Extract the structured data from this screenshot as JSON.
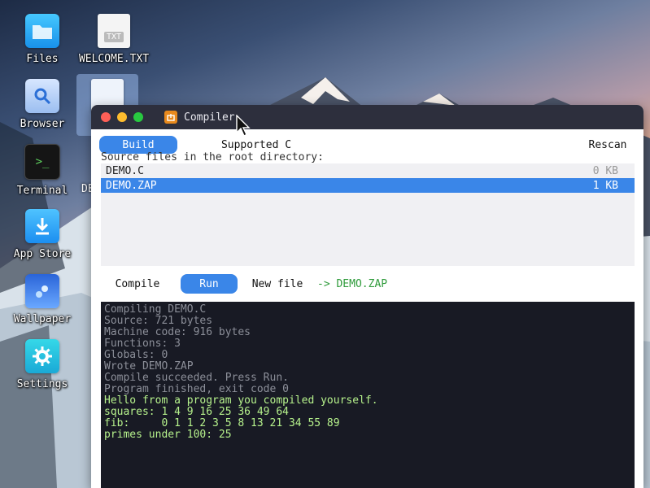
{
  "desktop": {
    "icons": [
      {
        "label": "Files",
        "icon": "folder-icon"
      },
      {
        "label": "WELCOME.TXT",
        "icon": "text-file-icon",
        "badge": "TXT"
      },
      {
        "label": "Browser",
        "icon": "magnifier-icon"
      },
      {
        "label": "Terminal",
        "icon": "terminal-icon",
        "glyph": ">_"
      },
      {
        "label": "DE",
        "icon": "file-icon"
      },
      {
        "label": "App Store",
        "icon": "download-icon"
      },
      {
        "label": "Wallpaper",
        "icon": "wallpaper-icon"
      },
      {
        "label": "Settings",
        "icon": "gear-icon"
      }
    ]
  },
  "window": {
    "title": "Compiler",
    "tabs": {
      "build": "Build",
      "supported": "Supported C"
    },
    "rescan": "Rescan",
    "hint": "Source files in the root directory:",
    "files": [
      {
        "name": "DEMO.C",
        "size": "0 KB",
        "selected": false
      },
      {
        "name": "DEMO.ZAP",
        "size": "1 KB",
        "selected": true
      }
    ],
    "actions": {
      "compile": "Compile",
      "run": "Run",
      "new_file": "New file",
      "output_target": "-> DEMO.ZAP"
    },
    "console": [
      {
        "text": "Compiling DEMO.C",
        "style": "dim"
      },
      {
        "text": "Source: 721 bytes",
        "style": "dim"
      },
      {
        "text": "Machine code: 916 bytes",
        "style": "dim"
      },
      {
        "text": "Functions: 3",
        "style": "dim"
      },
      {
        "text": "Globals: 0",
        "style": "dim"
      },
      {
        "text": "Wrote DEMO.ZAP",
        "style": "dim"
      },
      {
        "text": "Compile succeeded. Press Run.",
        "style": "dim"
      },
      {
        "text": "Program finished, exit code 0",
        "style": "dim"
      },
      {
        "text": "Hello from a program you compiled yourself.",
        "style": "ok"
      },
      {
        "text": "squares: 1 4 9 16 25 36 49 64",
        "style": "ok"
      },
      {
        "text": "fib:     0 1 1 2 3 5 8 13 21 34 55 89",
        "style": "ok"
      },
      {
        "text": "primes under 100: 25",
        "style": "ok"
      }
    ]
  },
  "colors": {
    "accent": "#3a86e8",
    "titlebar": "#2d2f3d",
    "console_bg": "#181a24",
    "console_ok": "#b6f28c",
    "console_dim": "#8c8f99",
    "traffic_close": "#ff5f57",
    "traffic_min": "#febc2e",
    "traffic_max": "#28c840"
  }
}
